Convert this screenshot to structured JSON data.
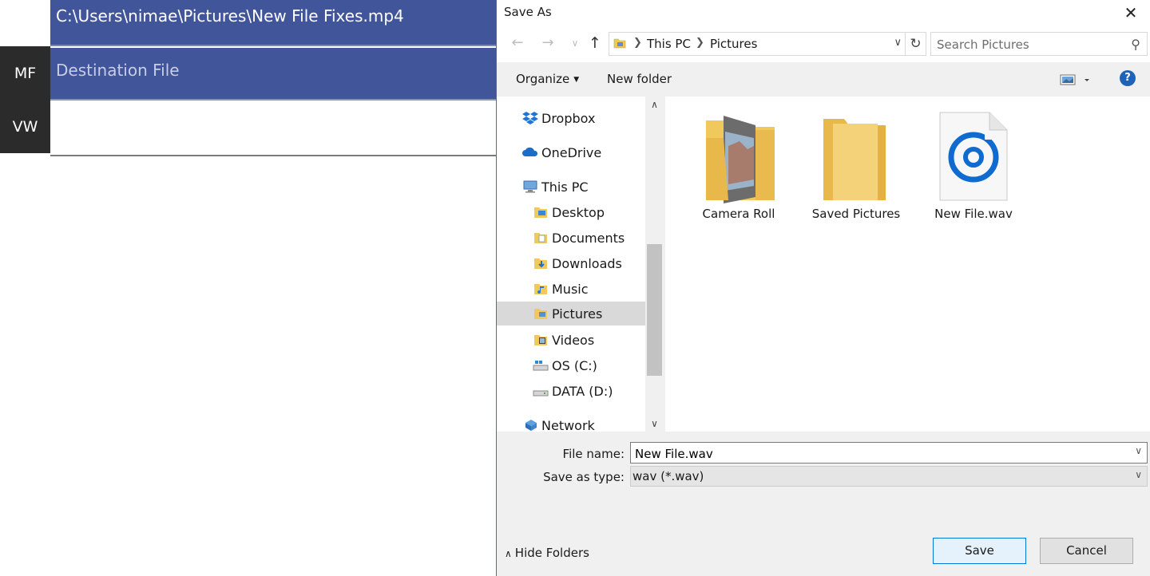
{
  "app": {
    "sidebar_tabs": [
      {
        "label": "MF"
      },
      {
        "label": "VW"
      }
    ],
    "source_path": "C:\\Users\\nimae\\Pictures\\New File Fixes.mp4",
    "destination_placeholder": "Destination File"
  },
  "dialog": {
    "title": "Save As",
    "close_symbol": "✕",
    "address": {
      "crumbs": [
        "This PC",
        "Pictures"
      ]
    },
    "search_placeholder": "Search Pictures",
    "toolbar": {
      "organize_label": "Organize",
      "new_folder_label": "New folder",
      "help_symbol": "?"
    },
    "nav_items": [
      {
        "label": "Dropbox",
        "icon": "dropbox-icon"
      },
      {
        "label": "OneDrive",
        "icon": "onedrive-icon"
      },
      {
        "label": "This PC",
        "icon": "computer-icon"
      },
      {
        "label": "Desktop",
        "icon": "folder-icon"
      },
      {
        "label": "Documents",
        "icon": "folder-icon"
      },
      {
        "label": "Downloads",
        "icon": "folder-icon"
      },
      {
        "label": "Music",
        "icon": "folder-icon"
      },
      {
        "label": "Pictures",
        "icon": "folder-icon",
        "selected": true
      },
      {
        "label": "Videos",
        "icon": "folder-icon"
      },
      {
        "label": "OS (C:)",
        "icon": "drive-icon"
      },
      {
        "label": "DATA (D:)",
        "icon": "drive-icon"
      },
      {
        "label": "Network",
        "icon": "network-icon"
      }
    ],
    "files": [
      {
        "label": "Camera Roll",
        "icon": "photo-folder-icon"
      },
      {
        "label": "Saved Pictures",
        "icon": "folder-icon"
      },
      {
        "label": "New File.wav",
        "icon": "audio-file-icon"
      }
    ],
    "form": {
      "file_name_label": "File name:",
      "file_name_value": "New File.wav",
      "save_type_label": "Save as type:",
      "save_type_value": "wav (*.wav)"
    },
    "hide_folders_label": "Hide Folders",
    "save_label": "Save",
    "cancel_label": "Cancel"
  },
  "colors": {
    "app_accent": "#41559b",
    "selection": "#d9d9d9",
    "focus_blue": "#0078d7"
  }
}
